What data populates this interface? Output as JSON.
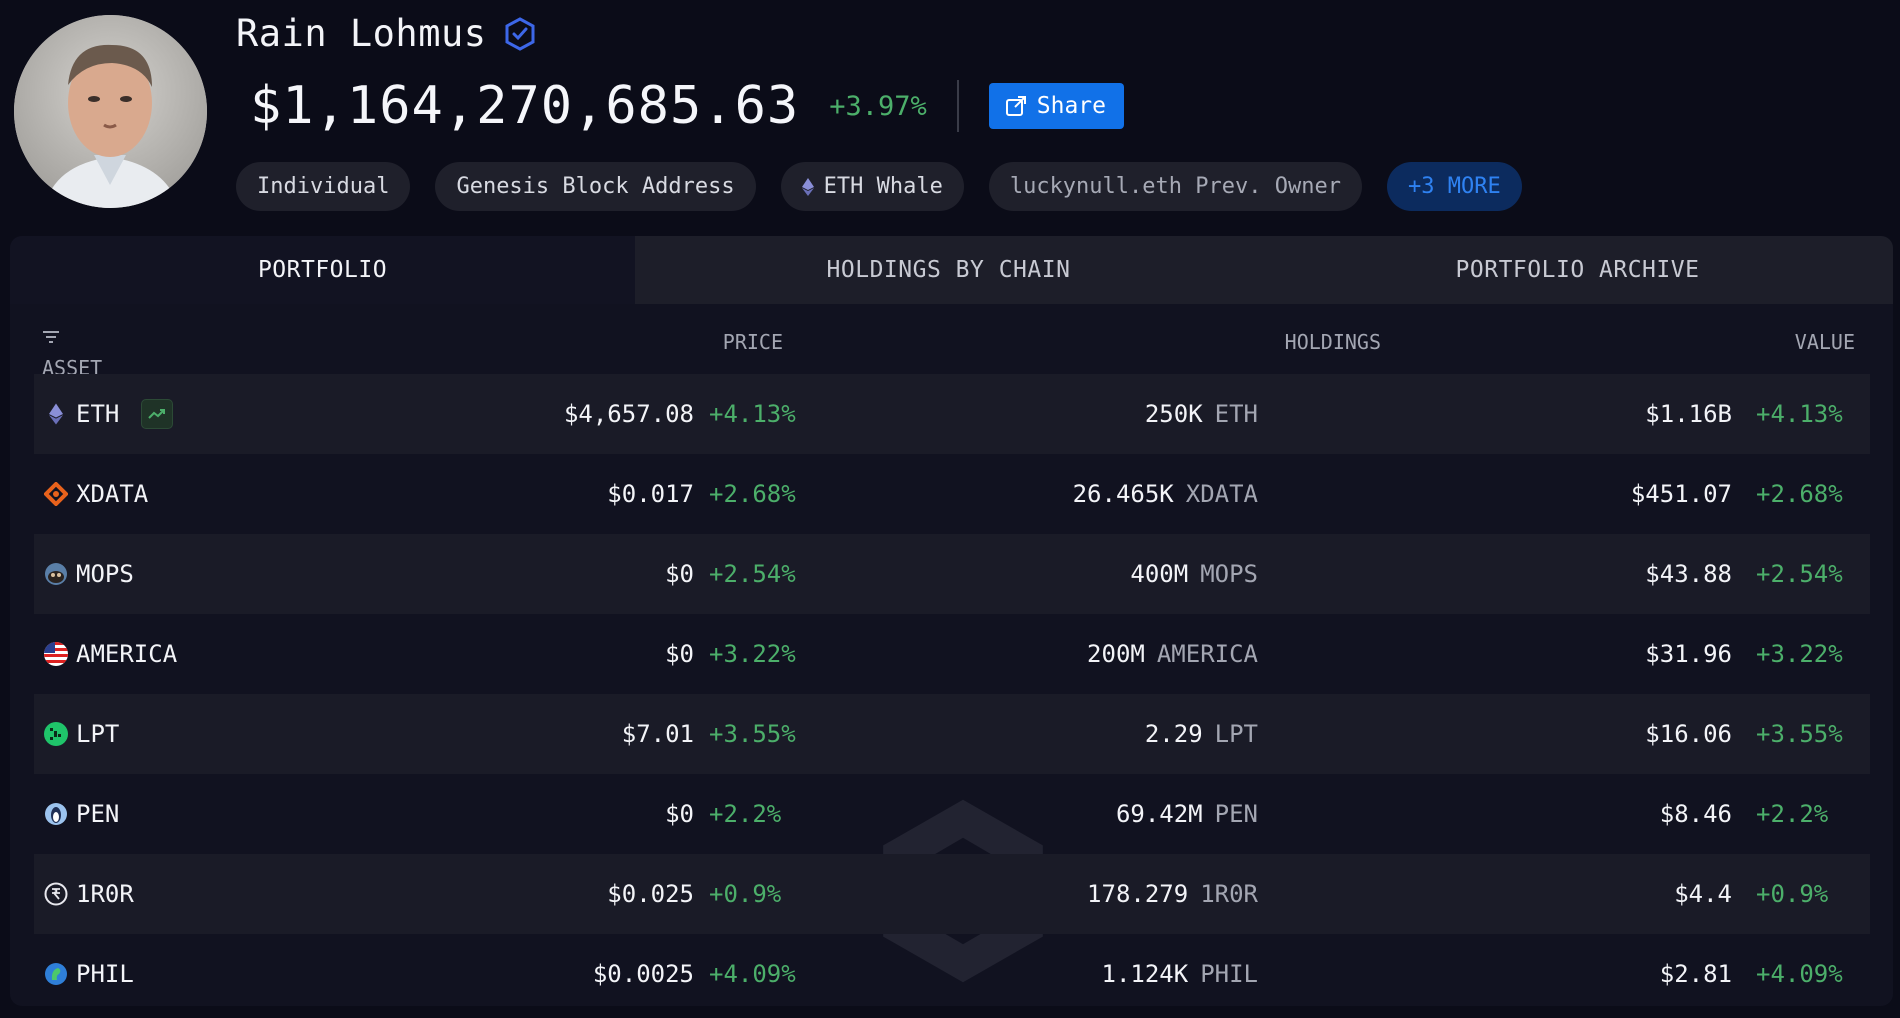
{
  "profile": {
    "name": "Rain Lohmus",
    "total_value": "$1,164,270,685.63",
    "change": "+3.97%",
    "share_label": "Share",
    "tags": [
      {
        "label": "Individual",
        "icon": ""
      },
      {
        "label": "Genesis Block Address",
        "icon": ""
      },
      {
        "label": "ETH Whale",
        "icon": "eth-icon"
      },
      {
        "label": "luckynull.eth Prev. Owner",
        "icon": ""
      },
      {
        "label": "+3 MORE",
        "icon": ""
      }
    ]
  },
  "tabs": [
    "PORTFOLIO",
    "HOLDINGS BY CHAIN",
    "PORTFOLIO ARCHIVE"
  ],
  "table": {
    "headers": {
      "asset": "ASSET",
      "price": "PRICE",
      "holdings": "HOLDINGS",
      "value": "VALUE"
    },
    "rows": [
      {
        "asset": "ETH",
        "price": "$4,657.08",
        "price_change": "+4.13%",
        "holdings": "250K",
        "symbol": "ETH",
        "value": "$1.16B",
        "value_change": "+4.13%"
      },
      {
        "asset": "XDATA",
        "price": "$0.017",
        "price_change": "+2.68%",
        "holdings": "26.465K",
        "symbol": "XDATA",
        "value": "$451.07",
        "value_change": "+2.68%"
      },
      {
        "asset": "MOPS",
        "price": "$0",
        "price_change": "+2.54%",
        "holdings": "400M",
        "symbol": "MOPS",
        "value": "$43.88",
        "value_change": "+2.54%"
      },
      {
        "asset": "AMERICA",
        "price": "$0",
        "price_change": "+3.22%",
        "holdings": "200M",
        "symbol": "AMERICA",
        "value": "$31.96",
        "value_change": "+3.22%"
      },
      {
        "asset": "LPT",
        "price": "$7.01",
        "price_change": "+3.55%",
        "holdings": "2.29",
        "symbol": "LPT",
        "value": "$16.06",
        "value_change": "+3.55%"
      },
      {
        "asset": "PEN",
        "price": "$0",
        "price_change": "+2.2%",
        "holdings": "69.42M",
        "symbol": "PEN",
        "value": "$8.46",
        "value_change": "+2.2%"
      },
      {
        "asset": "1R0R",
        "price": "$0.025",
        "price_change": "+0.9%",
        "holdings": "178.279",
        "symbol": "1R0R",
        "value": "$4.4",
        "value_change": "+0.9%"
      },
      {
        "asset": "PHIL",
        "price": "$0.0025",
        "price_change": "+4.09%",
        "holdings": "1.124K",
        "symbol": "PHIL",
        "value": "$2.81",
        "value_change": "+4.09%"
      }
    ]
  },
  "colors": {
    "accent": "#1171e8",
    "positive": "#4caf6a",
    "background": "#0b0c18"
  }
}
